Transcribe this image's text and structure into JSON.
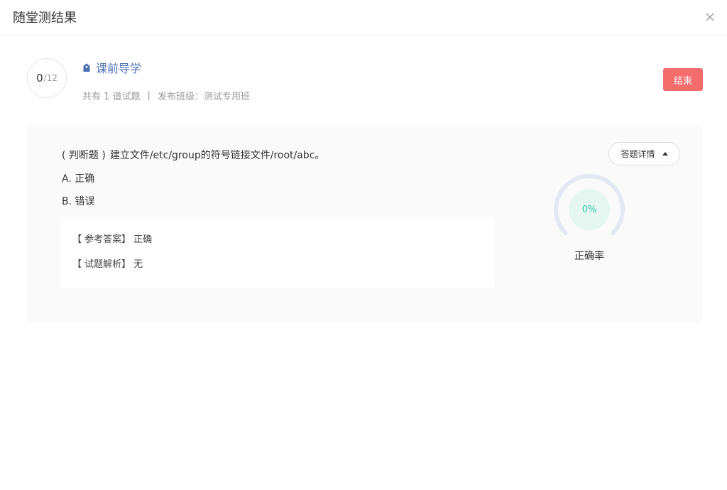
{
  "dialog": {
    "title": "随堂测结果"
  },
  "summary": {
    "score": "0",
    "total": "/12",
    "lesson_title": "课前导学",
    "question_count_text": "共有 1 道试题",
    "separator": "|",
    "class_label": "发布班级：",
    "class_name": "测试专用班",
    "end_button": "结束"
  },
  "question": {
    "type_label": "( 判断题 )",
    "stem": "建立文件/etc/group的符号链接文件/root/abc。",
    "options": [
      {
        "text": "A. 正确"
      },
      {
        "text": "B. 错误"
      }
    ],
    "reference_answer_key": "【 参考答案】",
    "reference_answer_value": "正确",
    "analysis_key": "【 试题解析】",
    "analysis_value": "无",
    "detail_button": "答题详情",
    "accuracy_percent": "0%",
    "accuracy_value": 0,
    "accuracy_label": "正确率"
  },
  "colors": {
    "accent_blue": "#4a6fb5",
    "end_button": "#f56c6c",
    "gauge_ring": "#e3e8f2",
    "gauge_inner": "#e6f7f2",
    "gauge_text": "#2ec8a0"
  },
  "icons": {
    "close": "close-icon",
    "lesson": "lesson-tag-icon",
    "caret": "caret-up-icon"
  }
}
